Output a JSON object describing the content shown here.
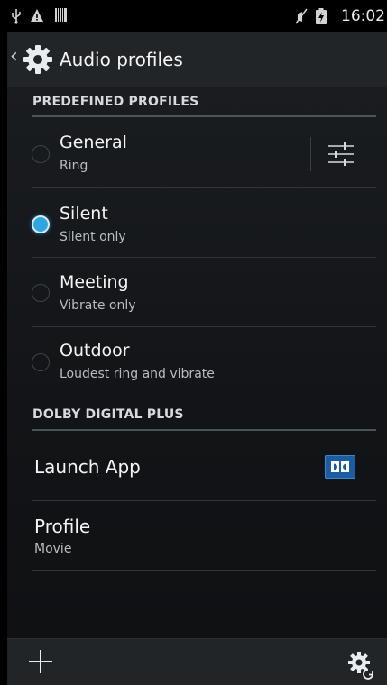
{
  "status_bar": {
    "time": "16:02",
    "left_icons": [
      "usb-icon",
      "warning-icon",
      "barcode-icon"
    ],
    "right_icons": [
      "mute-icon",
      "battery-charging-icon"
    ]
  },
  "action_bar": {
    "title": "Audio profiles"
  },
  "sections": {
    "predefined": "PREDEFINED PROFILES",
    "dolby": "DOLBY DIGITAL PLUS"
  },
  "profiles": [
    {
      "title": "General",
      "subtitle": "Ring",
      "selected": false
    },
    {
      "title": "Silent",
      "subtitle": "Silent only",
      "selected": true
    },
    {
      "title": "Meeting",
      "subtitle": "Vibrate only",
      "selected": false
    },
    {
      "title": "Outdoor",
      "subtitle": "Loudest ring and vibrate",
      "selected": false
    }
  ],
  "dolby": {
    "launch_label": "Launch App",
    "profile_label": "Profile",
    "profile_value": "Movie"
  },
  "colors": {
    "accent": "#2fa6e2",
    "background": "#16191c",
    "dolby_blue": "#1b5da0"
  }
}
